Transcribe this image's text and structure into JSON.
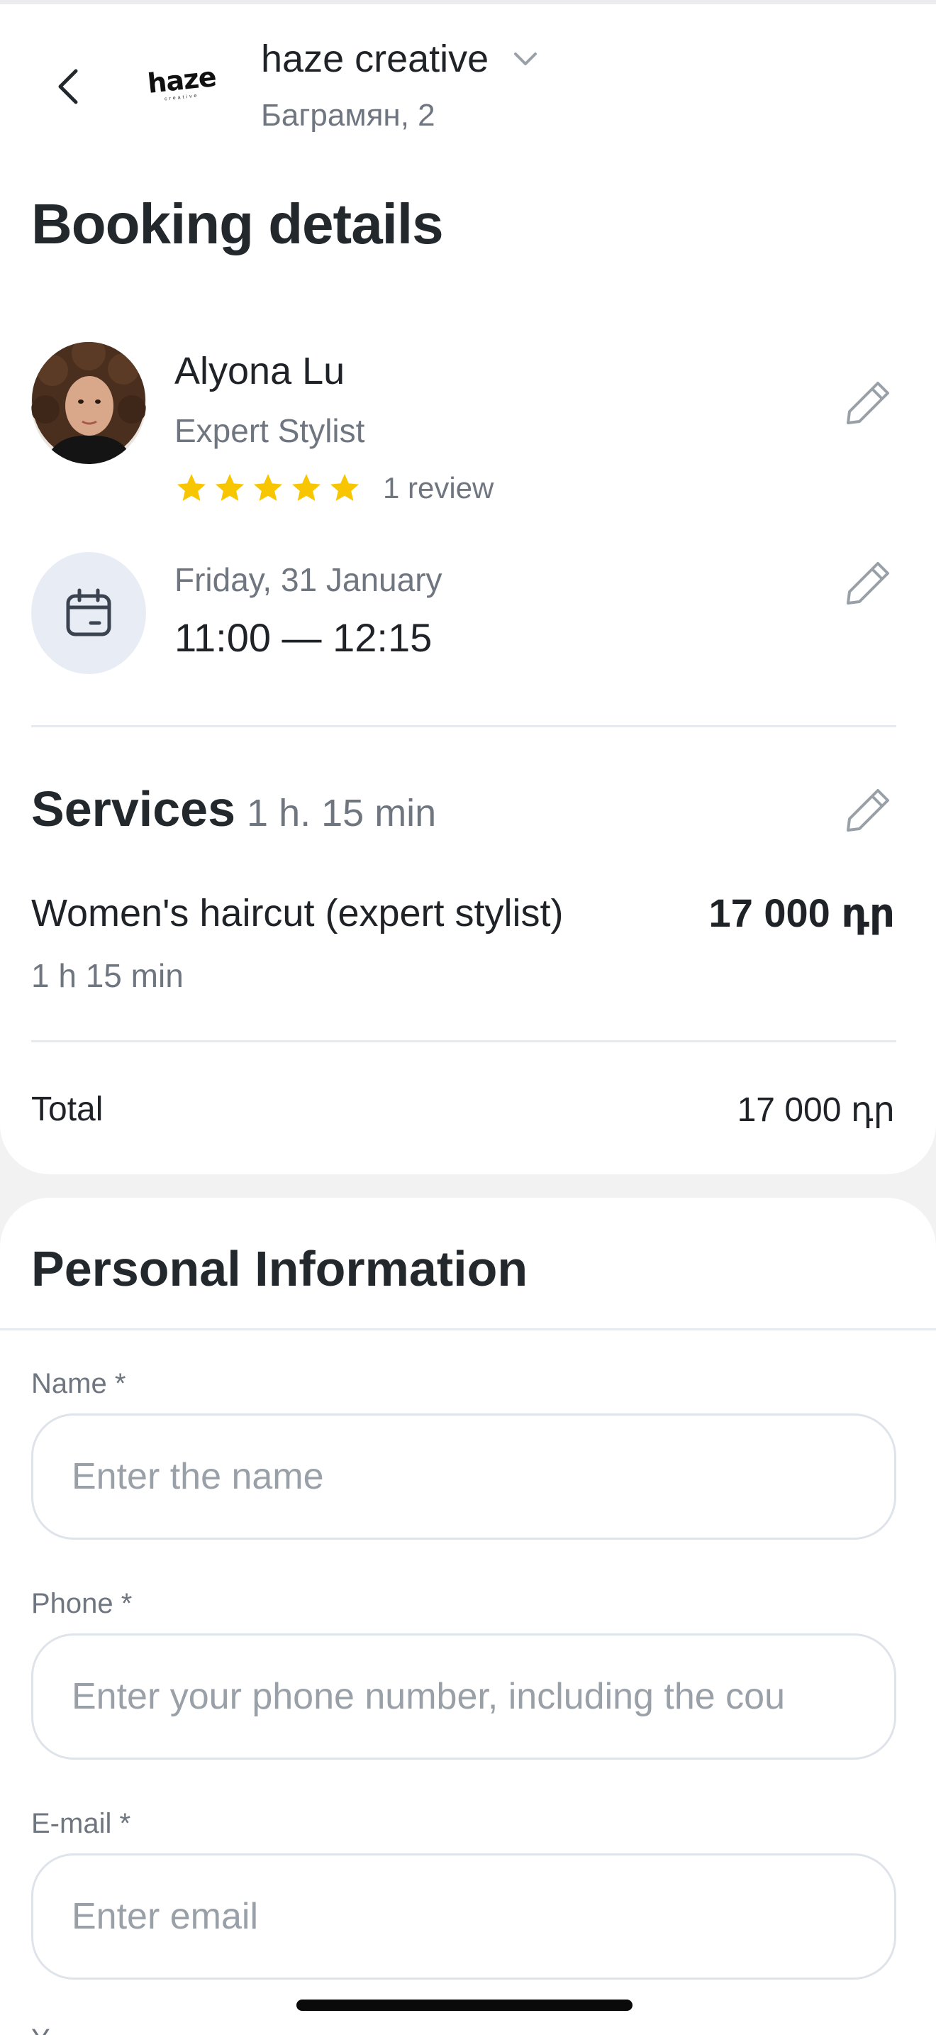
{
  "header": {
    "salon_logo_text": "haze",
    "salon_logo_subtext": "creative",
    "salon_name": "haze creative",
    "salon_address": "Баграмян, 2"
  },
  "page_title": "Booking details",
  "staff": {
    "name": "Alyona Lu",
    "role": "Expert Stylist",
    "rating": 5,
    "rating_max": 5,
    "review_count": "1 review"
  },
  "appointment": {
    "date": "Friday, 31 January",
    "time_range": "11:00 — 12:15"
  },
  "services": {
    "title": "Services",
    "total_duration": "1 h. 15 min",
    "items": [
      {
        "name": "Women's haircut (expert stylist)",
        "duration": "1 h 15 min",
        "price": "17 000 դր"
      }
    ],
    "total_label": "Total",
    "total_value": "17 000 դր"
  },
  "personal_info": {
    "title": "Personal Information",
    "name_label": "Name *",
    "name_placeholder": "Enter the name",
    "phone_label": "Phone *",
    "phone_placeholder": "Enter your phone number, including the cou",
    "email_label": "E-mail *",
    "email_placeholder": "Enter email",
    "next_label_partial": "Y"
  },
  "colors": {
    "star": "#f7c600",
    "muted_text": "#6f7680",
    "calendar_bg": "#e8ecf4",
    "input_border": "#dfe3ea"
  },
  "icons": [
    "back-arrow-icon",
    "chevron-down-icon",
    "pencil-icon",
    "calendar-icon",
    "star-icon"
  ]
}
